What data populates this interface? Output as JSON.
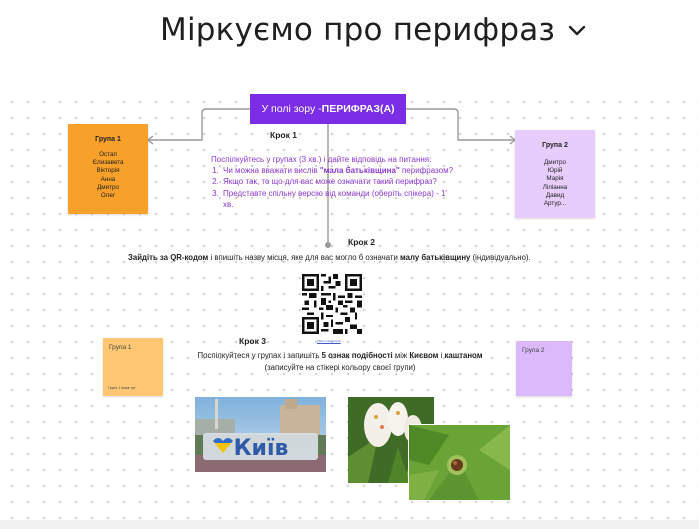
{
  "header": {
    "title": "Міркуємо про перифраз"
  },
  "banner": {
    "prefix": "У полі зору - ",
    "bold": "ПЕРИФРАЗ(А)"
  },
  "group1": {
    "title": "Група 1",
    "names": [
      "Остап",
      "Єлизавета",
      "Вікторія",
      "Анна",
      "Дмитро",
      "Олег"
    ]
  },
  "group2": {
    "title": "Група 2",
    "names": [
      "Дмитро",
      "Юрій",
      "Марія",
      "Ліліанна",
      "Давид",
      "Артур..."
    ]
  },
  "step1": {
    "label": "Крок 1",
    "intro": "Поспілкуйтесь у групах (3 хв.) і дайте відповідь на питання:",
    "q1_a": "Чи можна вважати вислів ",
    "q1_b": "\"мала батьківщина\"",
    "q1_c": " перифразом?",
    "q2": "Якщо так, то що для вас може означати такий перифраз?",
    "q3": "Представте спільну версію від команди (оберіть спікера) - 1' хв."
  },
  "step2": {
    "label": "Крок 2",
    "t1": "Зайдіть за ",
    "t2": "QR-кодом",
    "t3": " і впишіть назву місця, яке для вас могло б означати ",
    "t4": "малу батьківщину",
    "t5": " (індивідуально).",
    "link": "https://example"
  },
  "step3": {
    "label": "Крок 3",
    "t1": "Поспілкуйтеся у групах і запишіть ",
    "t2": "5 ознак подібності",
    "t3": " між ",
    "t4": "Києвом",
    "t5": " і ",
    "t6": "каштаном",
    "t7": "(записуйте на стікері кольору своєї групи)"
  },
  "note3": {
    "title": "Група 1",
    "small": "Група 1 пише тут"
  },
  "note4": {
    "title": "Група 2"
  },
  "photos": {
    "kyiv_sign": "Київ",
    "icons": [
      "chevron-down-icon",
      "qr-code-icon"
    ]
  },
  "colors": {
    "accent": "#7c2ee6",
    "orange": "#f7a02a",
    "lilac": "#e7cdfb",
    "question_text": "#8b37cf"
  }
}
